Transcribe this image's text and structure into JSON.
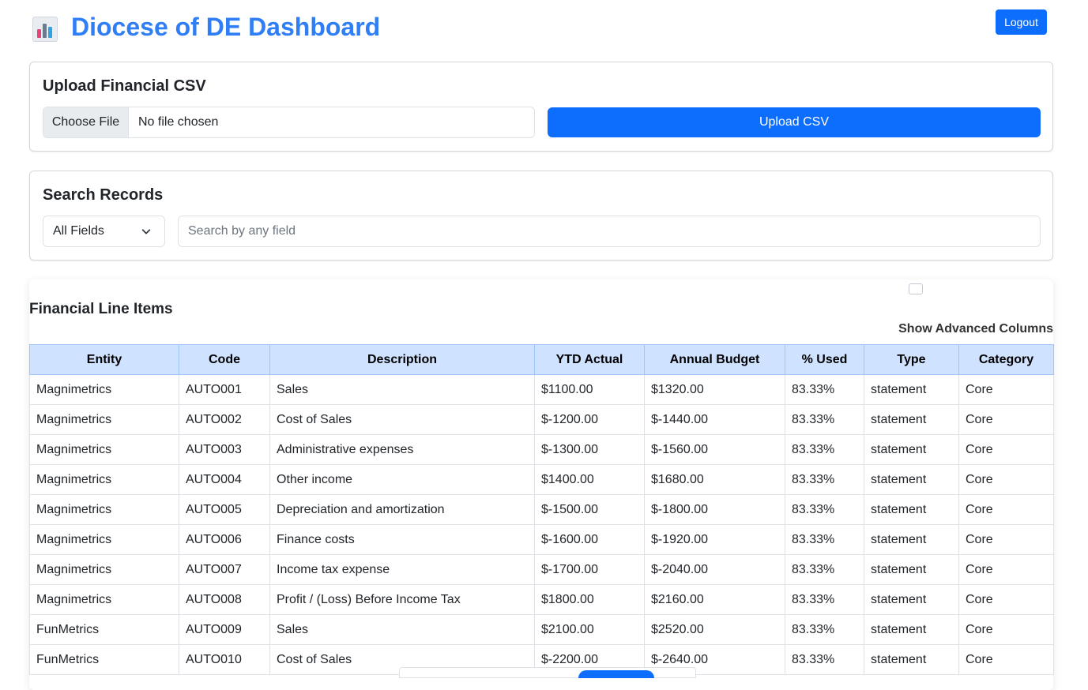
{
  "header": {
    "title": "Diocese of DE Dashboard",
    "logo_icon": "bar-chart-icon",
    "logout_label": "Logout"
  },
  "upload": {
    "title": "Upload Financial CSV",
    "choose_file_label": "Choose File",
    "file_status": "No file chosen",
    "upload_button_label": "Upload CSV"
  },
  "search": {
    "title": "Search Records",
    "field_selected": "All Fields",
    "placeholder": "Search by any field"
  },
  "table": {
    "title": "Financial Line Items",
    "advanced_toggle_label": "Show Advanced Columns",
    "advanced_checked": false,
    "columns": [
      "Entity",
      "Code",
      "Description",
      "YTD Actual",
      "Annual Budget",
      "% Used",
      "Type",
      "Category"
    ],
    "rows": [
      [
        "Magnimetrics",
        "AUTO001",
        "Sales",
        "$1100.00",
        "$1320.00",
        "83.33%",
        "statement",
        "Core"
      ],
      [
        "Magnimetrics",
        "AUTO002",
        "Cost of Sales",
        "$-1200.00",
        "$-1440.00",
        "83.33%",
        "statement",
        "Core"
      ],
      [
        "Magnimetrics",
        "AUTO003",
        "Administrative expenses",
        "$-1300.00",
        "$-1560.00",
        "83.33%",
        "statement",
        "Core"
      ],
      [
        "Magnimetrics",
        "AUTO004",
        "Other income",
        "$1400.00",
        "$1680.00",
        "83.33%",
        "statement",
        "Core"
      ],
      [
        "Magnimetrics",
        "AUTO005",
        "Depreciation and amortization",
        "$-1500.00",
        "$-1800.00",
        "83.33%",
        "statement",
        "Core"
      ],
      [
        "Magnimetrics",
        "AUTO006",
        "Finance costs",
        "$-1600.00",
        "$-1920.00",
        "83.33%",
        "statement",
        "Core"
      ],
      [
        "Magnimetrics",
        "AUTO007",
        "Income tax expense",
        "$-1700.00",
        "$-2040.00",
        "83.33%",
        "statement",
        "Core"
      ],
      [
        "Magnimetrics",
        "AUTO008",
        "Profit / (Loss) Before Income Tax",
        "$1800.00",
        "$2160.00",
        "83.33%",
        "statement",
        "Core"
      ],
      [
        "FunMetrics",
        "AUTO009",
        "Sales",
        "$2100.00",
        "$2520.00",
        "83.33%",
        "statement",
        "Core"
      ],
      [
        "FunMetrics",
        "AUTO010",
        "Cost of Sales",
        "$-2200.00",
        "$-2640.00",
        "83.33%",
        "statement",
        "Core"
      ]
    ]
  },
  "colors": {
    "title": "#2f7ef6",
    "primary_button": "#0d6efd",
    "table_header_bg": "#cfe2ff"
  }
}
